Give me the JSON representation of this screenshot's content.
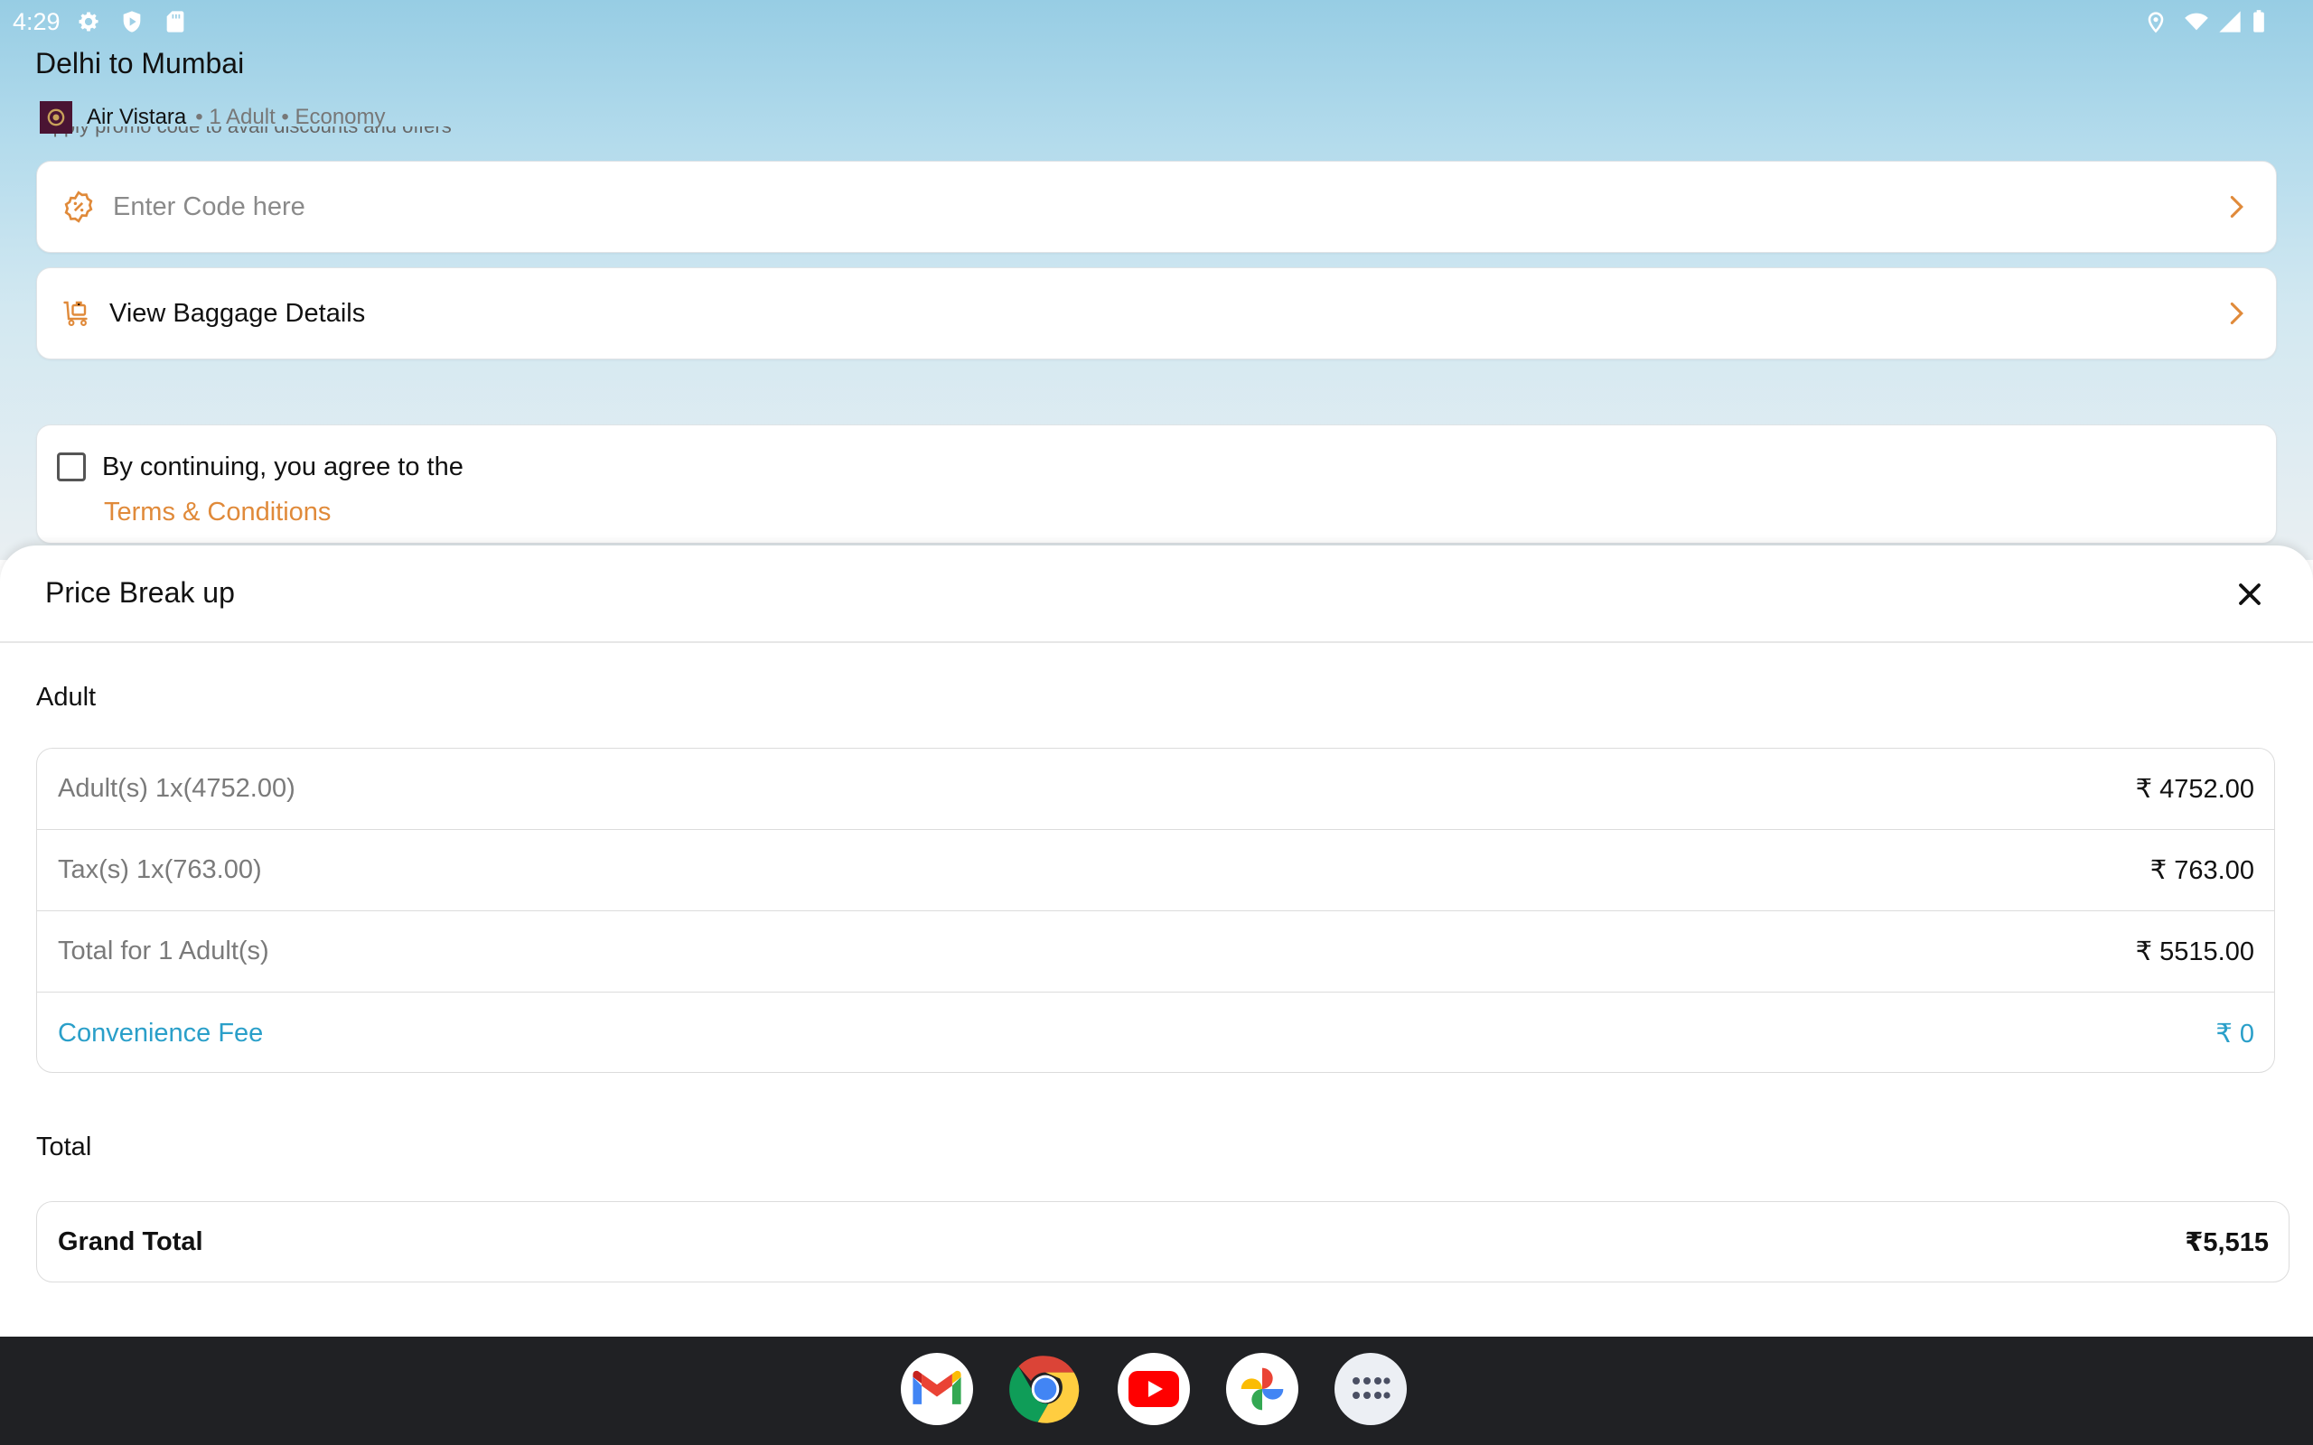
{
  "status_bar": {
    "time": "4:29",
    "icons_left": [
      "gear-icon",
      "shield-play-icon",
      "sd-card-icon"
    ],
    "icons_right": [
      "location-icon",
      "wifi-icon",
      "signal-icon",
      "battery-icon"
    ]
  },
  "header": {
    "route": "Delhi to Mumbai",
    "airline": "Air Vistara",
    "meta": "• 1 Adult • Economy",
    "promo_hint": "Apply promo code to avail discounts and offers"
  },
  "promo": {
    "placeholder": "Enter Code here",
    "icon": "discount-badge-icon"
  },
  "baggage": {
    "label": "View Baggage Details",
    "icon": "luggage-cart-icon"
  },
  "terms": {
    "text": "By continuing, you agree to the",
    "link": "Terms & Conditions",
    "checked": false
  },
  "sheet": {
    "title": "Price Break up",
    "adult_section": "Adult",
    "rows": [
      {
        "label": "Adult(s) 1x(4752.00)",
        "value": "₹ 4752.00"
      },
      {
        "label": "Tax(s) 1x(763.00)",
        "value": "₹ 763.00"
      },
      {
        "label": "Total for 1 Adult(s)",
        "value": "₹ 5515.00"
      },
      {
        "label": "Convenience Fee",
        "value": "₹ 0"
      }
    ],
    "total_section": "Total",
    "grand_total_label": "Grand Total",
    "grand_total_value": "₹5,515"
  },
  "dock": {
    "apps": [
      "gmail-icon",
      "chrome-icon",
      "youtube-icon",
      "photos-icon",
      "app-drawer-icon"
    ]
  },
  "colors": {
    "accent_orange": "#e08a3a",
    "fee_blue": "#2a9fc9",
    "nav_bg": "#202124"
  }
}
